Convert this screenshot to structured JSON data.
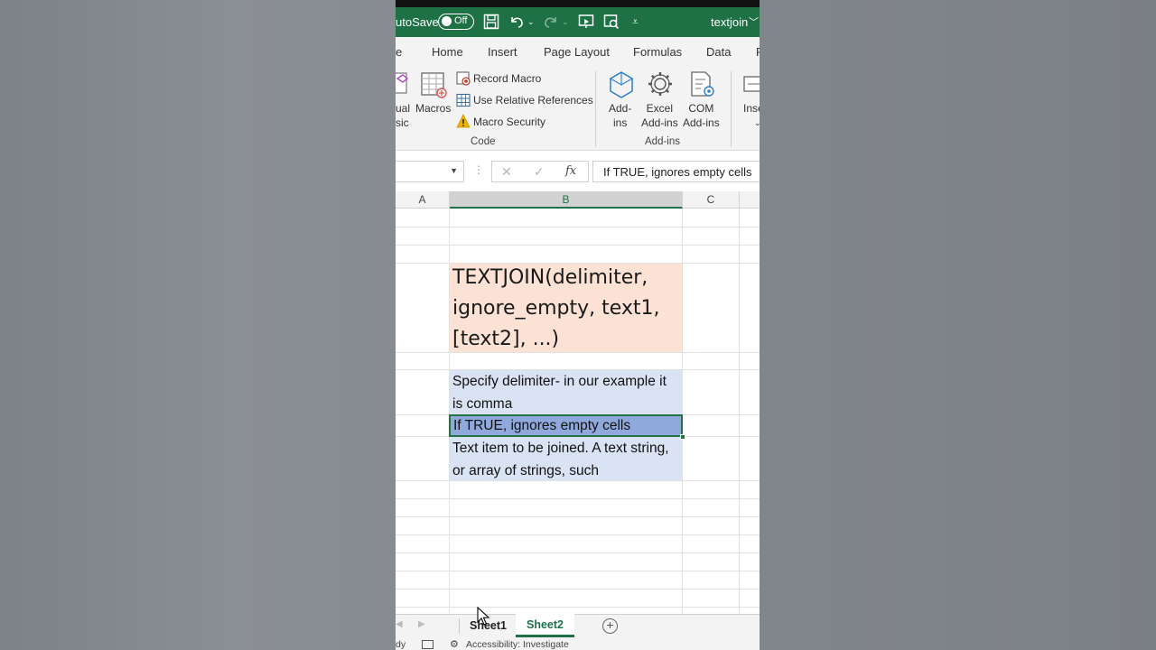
{
  "window": {
    "title_prefix": "utoSave",
    "autosave_state": "Off",
    "filename": "textjoin"
  },
  "tabs": [
    "e",
    "Home",
    "Insert",
    "Page Layout",
    "Formulas",
    "Data",
    "F"
  ],
  "ribbon": {
    "code_group": {
      "visual_basic_line1": "ual",
      "visual_basic_line2": "sic",
      "macros": "Macros",
      "record_macro": "Record Macro",
      "use_relative_references": "Use Relative References",
      "macro_security": "Macro Security",
      "label": "Code"
    },
    "addins_group": {
      "addins_line1": "Add-",
      "addins_line2": "ins",
      "excel_addins_line1": "Excel",
      "excel_addins_line2": "Add-ins",
      "com_addins_line1": "COM",
      "com_addins_line2": "Add-ins",
      "label": "Add-ins"
    },
    "insert_partial": "Inse"
  },
  "formula_bar": {
    "cancel_symbol": "✕",
    "enter_symbol": "✓",
    "fx_symbol": "fx",
    "value": "If TRUE, ignores empty cells"
  },
  "grid": {
    "columns": [
      "A",
      "B",
      "C"
    ],
    "syntax_cell": "TEXTJOIN(delimiter, ignore_empty, text1, [text2], ...)",
    "delimiter_desc": "Specify delimiter- in our example it is comma",
    "ignore_empty_desc": "If TRUE, ignores empty cells",
    "text_desc": "Text item to be joined. A text string, or array of strings, such"
  },
  "sheets": {
    "sheet1": "Sheet1",
    "sheet2": "Sheet2",
    "add_symbol": "+"
  },
  "status": {
    "ready_partial": "dy",
    "accessibility": "Accessibility: Investigate"
  },
  "colors": {
    "excel_green": "#1e7145",
    "syntax_fill": "#fbe2d5",
    "desc_fill": "#dae3f3",
    "selected_fill": "#8fa9dd"
  }
}
